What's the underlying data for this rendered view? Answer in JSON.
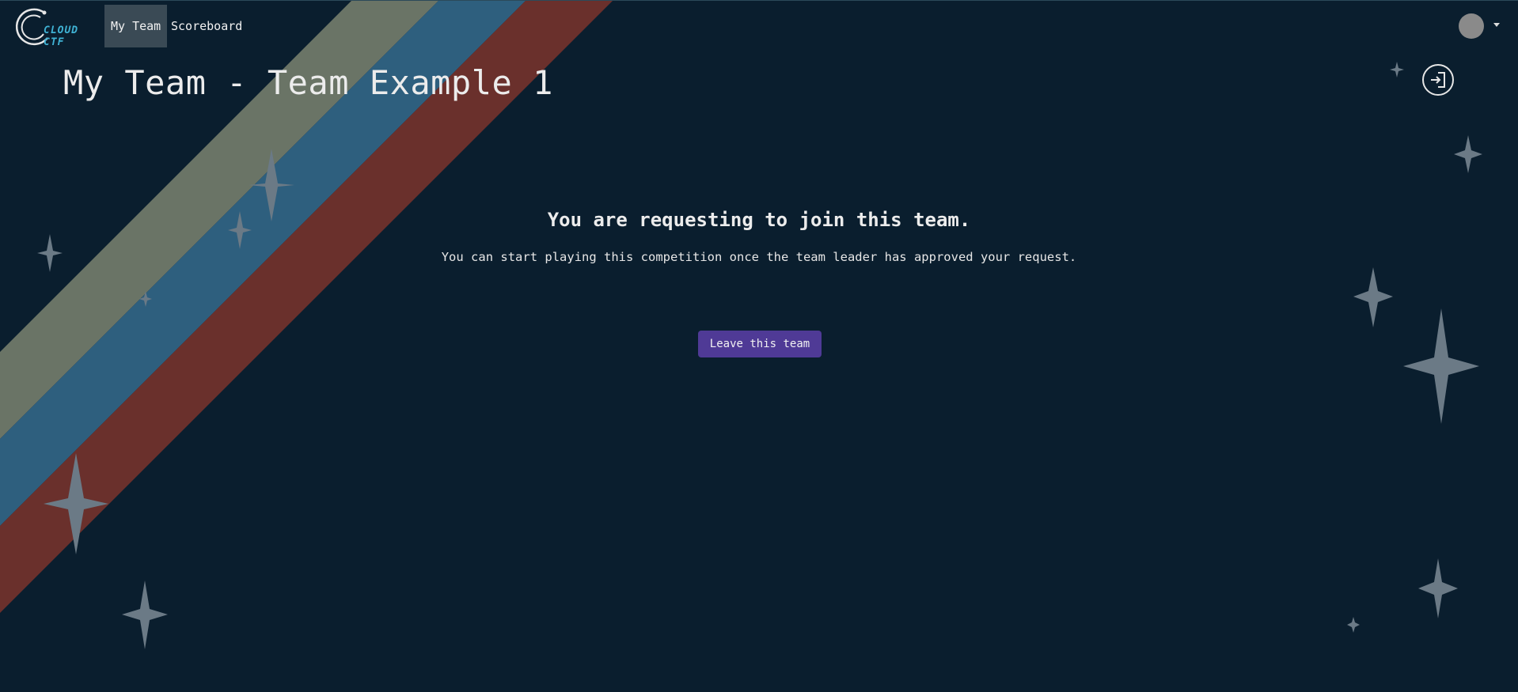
{
  "brand": {
    "logo_text": "CLOUD CTF"
  },
  "nav": {
    "links": [
      {
        "label": "My Team",
        "active": true
      },
      {
        "label": "Scoreboard",
        "active": false
      }
    ]
  },
  "user_menu": {
    "avatar_icon": "user-avatar-icon",
    "caret_icon": "chevron-down-icon"
  },
  "page": {
    "title": "My Team - Team Example 1",
    "exit_icon": "sign-in-arrow-icon"
  },
  "notice": {
    "title": "You are requesting to join this team.",
    "text": "You can start playing this competition once the team leader has approved your request."
  },
  "actions": {
    "leave_label": "Leave this team"
  },
  "colors": {
    "background": "#0a1e2e",
    "stripe_gray": "#6a7466",
    "stripe_blue": "#2e5f7e",
    "stripe_red": "#6a302c",
    "star": "#6b7a86",
    "button": "#4f3a96",
    "logo_accent": "#3fb2d4"
  }
}
